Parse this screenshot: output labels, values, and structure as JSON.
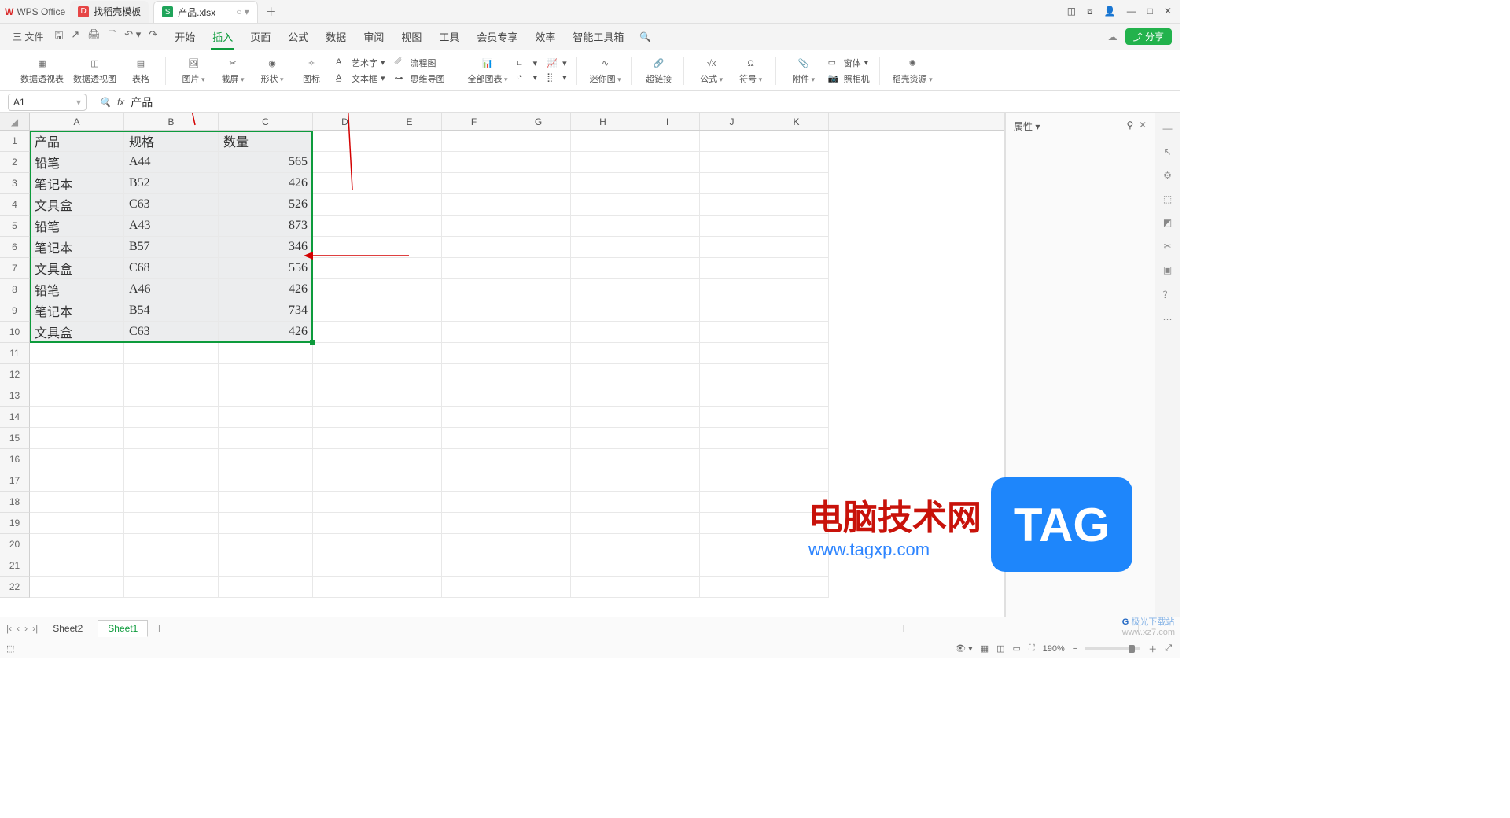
{
  "title": {
    "app": "WPS Office",
    "template_tab": "找稻壳模板",
    "file_tab": "产品.xlsx"
  },
  "menubar": {
    "file": "三 文件",
    "tabs": [
      "开始",
      "插入",
      "页面",
      "公式",
      "数据",
      "审阅",
      "视图",
      "工具",
      "会员专享",
      "效率",
      "智能工具箱"
    ],
    "active_index": 1,
    "share": "⤴ 分享"
  },
  "ribbon": {
    "pivot_table": "数据透视表",
    "pivot_chart": "数据透视图",
    "table": "表格",
    "picture": "图片",
    "screenshot": "截屏",
    "shapes": "形状",
    "icons": "图标",
    "artfont": "艺术字",
    "textbox": "文本框",
    "flowchart": "流程图",
    "mindmap": "思维导图",
    "allcharts": "全部图表",
    "sparkline": "迷你图",
    "hyperlink": "超链接",
    "formula": "公式",
    "symbol": "符号",
    "attachment": "附件",
    "camera": "照相机",
    "object": "窗体",
    "resources": "稻壳资源"
  },
  "formula_bar": {
    "cell_ref": "A1",
    "value": "产品"
  },
  "columns": [
    "A",
    "B",
    "C",
    "D",
    "E",
    "F",
    "G",
    "H",
    "I",
    "J",
    "K"
  ],
  "rows": 22,
  "table": {
    "headers": [
      "产品",
      "规格",
      "数量"
    ],
    "data": [
      [
        "铅笔",
        "A44",
        "565"
      ],
      [
        "笔记本",
        "B52",
        "426"
      ],
      [
        "文具盒",
        "C63",
        "526"
      ],
      [
        "铅笔",
        "A43",
        "873"
      ],
      [
        "笔记本",
        "B57",
        "346"
      ],
      [
        "文具盒",
        "C68",
        "556"
      ],
      [
        "铅笔",
        "A46",
        "426"
      ],
      [
        "笔记本",
        "B54",
        "734"
      ],
      [
        "文具盒",
        "C63",
        "426"
      ]
    ]
  },
  "sidepanel": {
    "title": "属性"
  },
  "sheets": {
    "items": [
      "Sheet2",
      "Sheet1"
    ],
    "active_index": 1
  },
  "statusbar": {
    "zoom": "190%"
  },
  "watermark": {
    "line1": "电脑技术网",
    "line2": "www.tagxp.com",
    "tag": "TAG",
    "dl": "极光下载站",
    "dl2": "www.xz7.com"
  }
}
